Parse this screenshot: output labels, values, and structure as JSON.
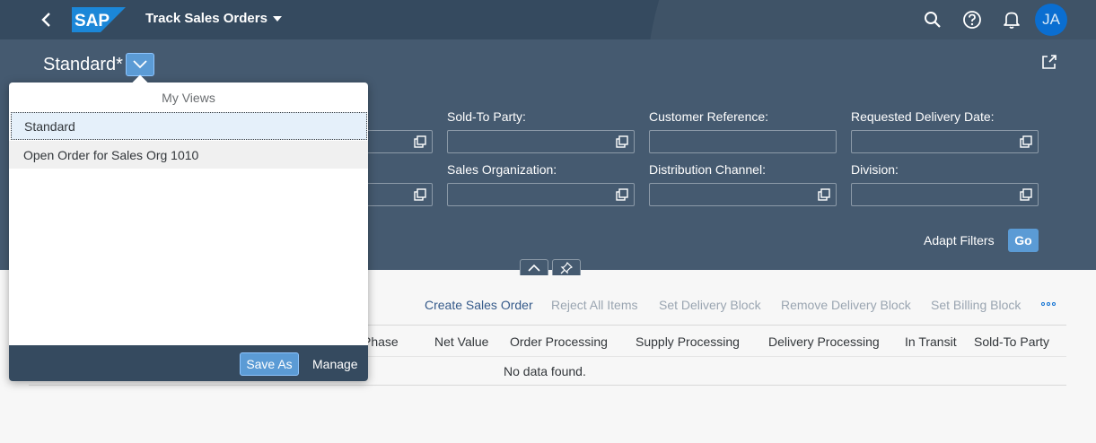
{
  "shell": {
    "logo_text": "SAP",
    "app_title": "Track Sales Orders",
    "avatar_initials": "JA"
  },
  "header": {
    "variant_name": "Standard*",
    "filters": [
      {
        "label": "Sold-To Party:",
        "value": ""
      },
      {
        "label": "Customer Reference:",
        "value": ""
      },
      {
        "label": "Requested Delivery Date:",
        "value": ""
      },
      {
        "label": "Sales Organization:",
        "value": ""
      },
      {
        "label": "Distribution Channel:",
        "value": ""
      },
      {
        "label": "Division:",
        "value": ""
      }
    ],
    "adapt_filters_label": "Adapt Filters",
    "go_label": "Go"
  },
  "toolbar": {
    "actions": [
      {
        "label": "Create Sales Order",
        "enabled": true
      },
      {
        "label": "Reject All Items",
        "enabled": false
      },
      {
        "label": "Set Delivery Block",
        "enabled": false
      },
      {
        "label": "Remove Delivery Block",
        "enabled": false
      },
      {
        "label": "Set Billing Block",
        "enabled": false
      }
    ]
  },
  "table": {
    "columns": [
      "Phase",
      "Net Value",
      "Order Processing",
      "Supply Processing",
      "Delivery Processing",
      "In Transit",
      "Sold-To Party"
    ],
    "empty_text": "No data found."
  },
  "variant_popover": {
    "title": "My Views",
    "items": [
      "Standard",
      "Open Order for Sales Org 1010"
    ],
    "selected_index": 0,
    "save_as_label": "Save As",
    "manage_label": "Manage"
  },
  "colors": {
    "shell_bg": "#354a5f",
    "header_bg": "#455a70",
    "accent": "#5b9bd5"
  }
}
